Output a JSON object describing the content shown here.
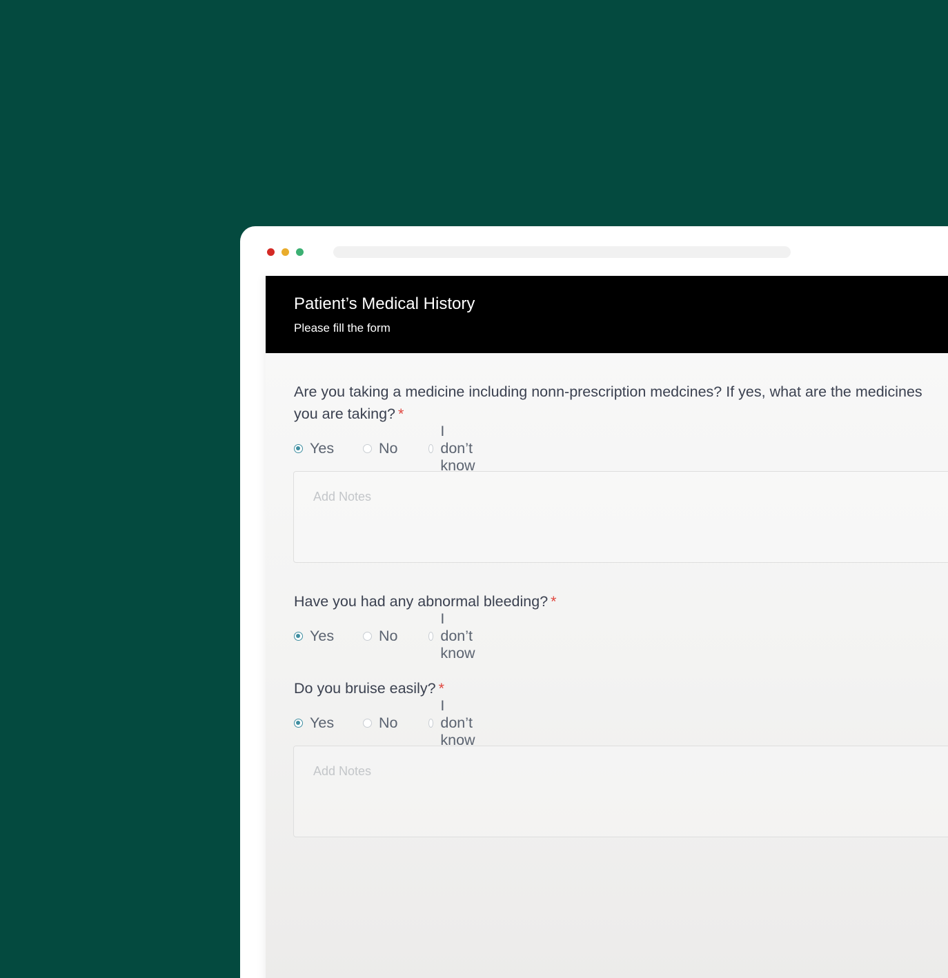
{
  "window": {
    "controls": [
      "close",
      "minimize",
      "maximize"
    ]
  },
  "form": {
    "title": "Patient’s Medical History",
    "subtitle": "Please fill the form",
    "required_marker": "*",
    "options": {
      "yes": "Yes",
      "no": "No",
      "dont_know": "I don’t know"
    },
    "notes_placeholder": "Add Notes",
    "questions": [
      {
        "text": "Are you taking a medicine including nonn-prescription  medcines? If yes, what are the medicines you are taking?",
        "selected": "Yes"
      },
      {
        "text": "Have you had any abnormal bleeding?",
        "selected": "Yes"
      },
      {
        "text": "Do you bruise easily?",
        "selected": "Yes"
      }
    ]
  },
  "colors": {
    "background": "#044a3f",
    "header": "#000000",
    "accent": "#3f8ea0",
    "required": "#e0473f"
  }
}
